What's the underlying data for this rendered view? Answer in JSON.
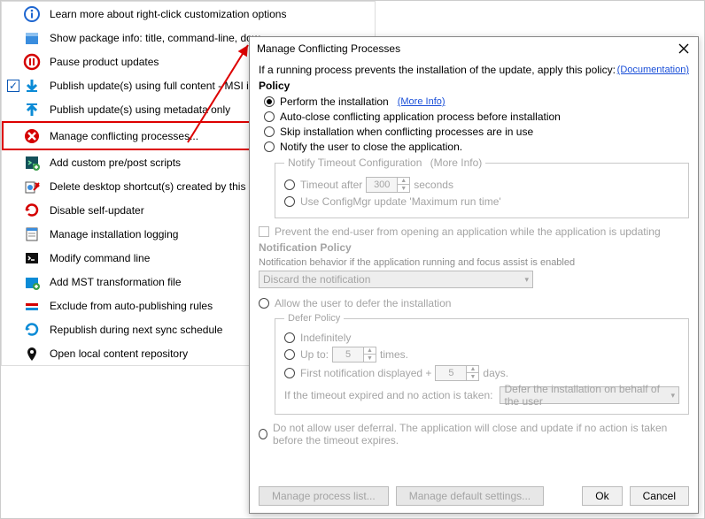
{
  "menu": {
    "items": [
      {
        "label": "Learn more about right-click customization options",
        "icon": "info"
      },
      {
        "label": "Show package info: title, command-line, dow",
        "icon": "package"
      },
      {
        "label": "Pause product updates",
        "icon": "pause"
      },
      {
        "label": "Publish update(s) using full content - MSI in",
        "icon": "down",
        "checked": true
      },
      {
        "label": "Publish update(s) using metadata only",
        "icon": "up"
      },
      {
        "label": "Manage conflicting processes...",
        "icon": "deny",
        "highlight": true
      },
      {
        "label": "Add custom pre/post scripts",
        "icon": "script"
      },
      {
        "label": "Delete desktop shortcut(s) created by this ap",
        "icon": "del"
      },
      {
        "label": "Disable self-updater",
        "icon": "refresh"
      },
      {
        "label": "Manage installation logging",
        "icon": "log"
      },
      {
        "label": "Modify command line",
        "icon": "cmd"
      },
      {
        "label": "Add MST transformation file",
        "icon": "mst"
      },
      {
        "label": "Exclude from auto-publishing rules",
        "icon": "exclude"
      },
      {
        "label": "Republish during next sync schedule",
        "icon": "republish"
      },
      {
        "label": "Open local content repository",
        "icon": "pin"
      }
    ]
  },
  "dialog": {
    "title": "Manage Conflicting Processes",
    "intro": "If a running process prevents the installation of the update, apply this policy:",
    "docLink": "(Documentation)",
    "policyHead": "Policy",
    "radios": {
      "perform": "Perform the installation",
      "autoclose": "Auto-close conflicting application process before installation",
      "skip": "Skip installation when conflicting processes are in use",
      "notify": "Notify the user to close the application."
    },
    "moreInfo": "(More Info)",
    "notifyLegend": "Notify Timeout Configuration",
    "timeoutAfter": "Timeout after",
    "timeoutVal": "300",
    "seconds": "seconds",
    "useConfigMgr": "Use ConfigMgr update 'Maximum run time'",
    "preventOpen": "Prevent the end-user from opening an application while the application is updating",
    "notifPolicyHead": "Notification Policy",
    "notifDesc": "Notification behavior if the application running and focus assist is enabled",
    "notifCombo": "Discard the notification",
    "allowDefer": "Allow the user to defer the installation",
    "deferLegend": "Defer Policy",
    "indef": "Indefinitely",
    "upto": "Up to:",
    "uptoVal": "5",
    "times": "times.",
    "firstNotif": "First notification displayed +",
    "firstVal": "5",
    "days": "days.",
    "timeoutExpired": "If the timeout expired and no action is taken:",
    "timeoutCombo": "Defer the installation on behalf of the user",
    "noDefer": "Do not allow user deferral. The application will close and update if no action is taken before the timeout expires.",
    "manageProcList": "Manage process list...",
    "manageDefaults": "Manage default settings...",
    "ok": "Ok",
    "cancel": "Cancel"
  }
}
